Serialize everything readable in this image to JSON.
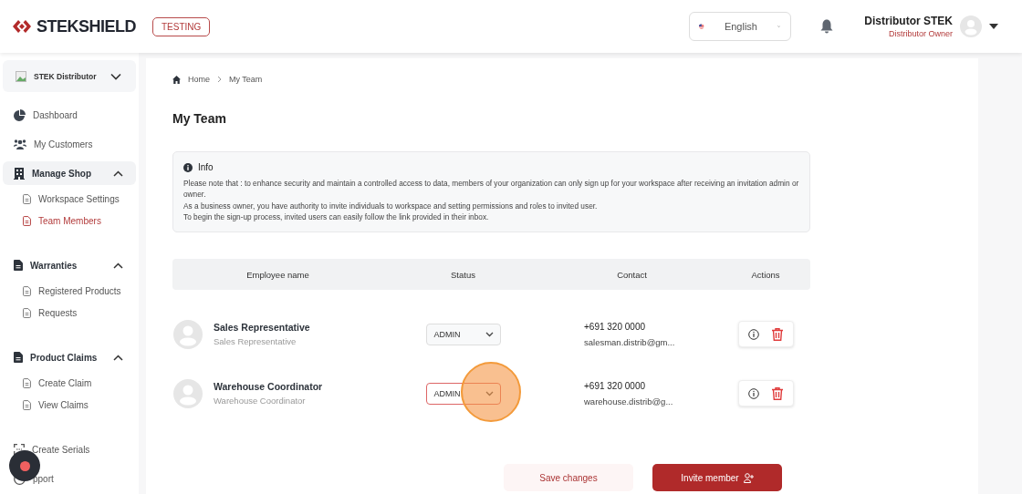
{
  "header": {
    "logo": "STEKSHIELD",
    "env_badge": "TESTING",
    "language": "English",
    "user": {
      "name": "Distributor STEK",
      "role": "Distributor Owner"
    }
  },
  "sidebar": {
    "workspace": "STEK Distributor",
    "items": [
      {
        "label": "Dashboard"
      },
      {
        "label": "My Customers"
      },
      {
        "label": "Manage Shop",
        "expanded": true,
        "children": [
          {
            "label": "Workspace Settings",
            "selected": false
          },
          {
            "label": "Team Members",
            "selected": true
          }
        ]
      },
      {
        "label": "Warranties",
        "expanded": true,
        "children": [
          {
            "label": "Registered Products",
            "selected": false
          },
          {
            "label": "Requests",
            "selected": false
          }
        ]
      },
      {
        "label": "Product Claims",
        "expanded": true,
        "children": [
          {
            "label": "Create Claim",
            "selected": false
          },
          {
            "label": "View Claims",
            "selected": false
          }
        ]
      },
      {
        "label": "Create Serials"
      },
      {
        "label": "pport"
      }
    ]
  },
  "breadcrumb": [
    "Home",
    "My Team"
  ],
  "title": "My Team",
  "info": {
    "title": "Info",
    "lines": [
      "Please note that : to enhance security and maintain a controlled access to data, members of your organization can only sign up for your workspace after receiving an invitation admin or owner.",
      "As a business owner, you have authority to invite individuals to workspace and setting permissions and roles to invited user.",
      "To begin the sign-up process, invited users can easily follow the link provided in their inbox."
    ]
  },
  "table": {
    "columns": [
      "Employee name",
      "Status",
      "Contact",
      "Actions"
    ],
    "rows": [
      {
        "name": "Sales Representative",
        "subtitle": "Sales Representative",
        "status": "ADMIN",
        "focused": false,
        "phone": "+691 320 0000",
        "email": "salesman.distrib@gm..."
      },
      {
        "name": "Warehouse Coordinator",
        "subtitle": "Warehouse Coordinator",
        "status": "ADMIN",
        "focused": true,
        "phone": "+691 320 0000",
        "email": "warehouse.distrib@g..."
      }
    ]
  },
  "buttons": {
    "save": "Save changes",
    "invite": "Invite member"
  }
}
